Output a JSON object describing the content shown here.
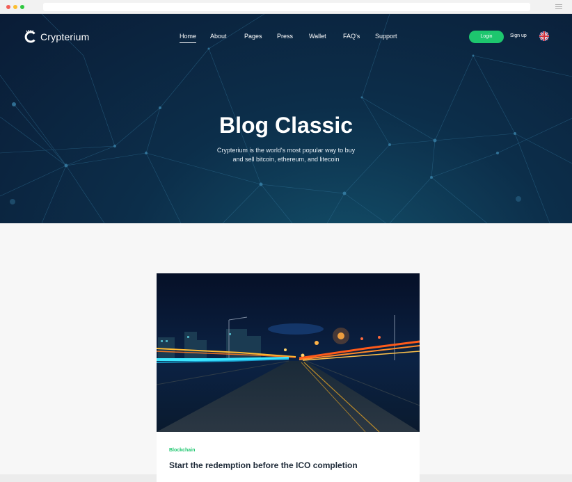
{
  "brand": {
    "name": "Crypterium"
  },
  "nav": {
    "items": [
      {
        "label": "Home",
        "active": true
      },
      {
        "label": "About",
        "active": false
      },
      {
        "label": "Pages",
        "active": false
      },
      {
        "label": "Press",
        "active": false
      },
      {
        "label": "Wallet",
        "active": false
      },
      {
        "label": "FAQ's",
        "active": false
      },
      {
        "label": "Support",
        "active": false
      }
    ],
    "login_label": "Login",
    "signup_label": "Sign up",
    "language_icon": "uk-flag-icon"
  },
  "hero": {
    "title": "Blog Classic",
    "subtitle": "Crypterium is the world's most popular way to buy and sell bitcoin, ethereum, and litecoin"
  },
  "post": {
    "category": "Blockchain",
    "title": "Start the redemption before the ICO completion",
    "image_icon": "night-road-light-trails-image"
  },
  "colors": {
    "accent": "#1dc66e",
    "hero_bg": "#0b2140"
  }
}
